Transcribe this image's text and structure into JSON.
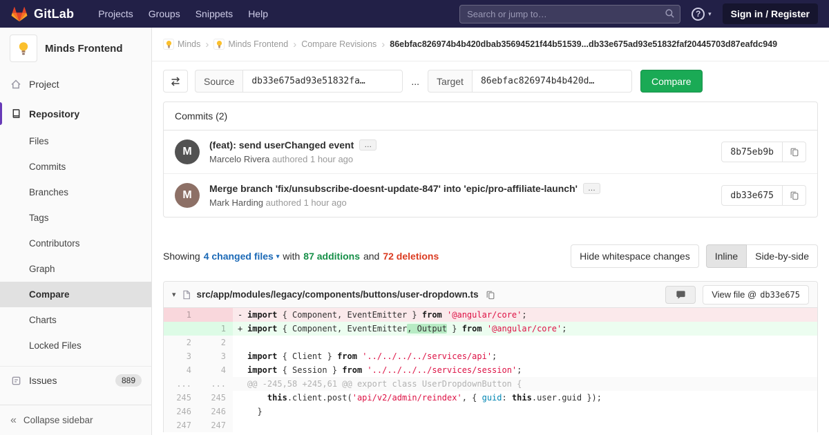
{
  "colors": {
    "navbar_bg": "#222047",
    "accent_purple": "#673ab7",
    "brand_orange": "#fc6d26",
    "green": "#1aaa55",
    "red": "#db3b21",
    "link_blue": "#1b69b6"
  },
  "navbar": {
    "brand": "GitLab",
    "links": [
      "Projects",
      "Groups",
      "Snippets",
      "Help"
    ],
    "search_placeholder": "Search or jump to…",
    "sign_in_label": "Sign in / Register"
  },
  "sidebar": {
    "project_name": "Minds Frontend",
    "top_items": [
      {
        "label": "Project",
        "active": false
      },
      {
        "label": "Repository",
        "active": true
      }
    ],
    "repository_subitems": [
      {
        "label": "Files",
        "active": false
      },
      {
        "label": "Commits",
        "active": false
      },
      {
        "label": "Branches",
        "active": false
      },
      {
        "label": "Tags",
        "active": false
      },
      {
        "label": "Contributors",
        "active": false
      },
      {
        "label": "Graph",
        "active": false
      },
      {
        "label": "Compare",
        "active": true
      },
      {
        "label": "Charts",
        "active": false
      },
      {
        "label": "Locked Files",
        "active": false
      }
    ],
    "issues_label": "Issues",
    "issues_count": "889",
    "collapse_label": "Collapse sidebar"
  },
  "breadcrumb": {
    "crumbs": [
      {
        "label": "Minds",
        "icon": "lightbulb"
      },
      {
        "label": "Minds Frontend",
        "icon": "lightbulb"
      },
      {
        "label": "Compare Revisions"
      }
    ],
    "current": "86ebfac826974b4b420dbab35694521f44b51539...db33e675ad93e51832faf20445703d87eafdc949"
  },
  "compare_form": {
    "source_label": "Source",
    "source_value": "db33e675ad93e51832fa…",
    "separator": "...",
    "target_label": "Target",
    "target_value": "86ebfac826974b4b420d…",
    "compare_button": "Compare"
  },
  "commits": {
    "title": "Commits (2)",
    "items": [
      {
        "title": "(feat): send userChanged event",
        "author": "Marcelo Rivera",
        "meta": "authored 1 hour ago",
        "sha": "8b75eb9b",
        "avatar_initial": "M",
        "avatar_color": "#525252"
      },
      {
        "title": "Merge branch 'fix/unsubscribe-doesnt-update-847' into 'epic/pro-affiliate-launch'",
        "author": "Mark Harding",
        "meta": "authored 1 hour ago",
        "sha": "db33e675",
        "avatar_initial": "M",
        "avatar_color": "#8d7066"
      }
    ]
  },
  "diff_summary": {
    "showing": "Showing",
    "files_link": "4 changed files",
    "with": "with",
    "additions": "87 additions",
    "and": "and",
    "deletions": "72 deletions",
    "hide_whitespace": "Hide whitespace changes",
    "inline": "Inline",
    "side_by_side": "Side-by-side"
  },
  "diff_file": {
    "path": "src/app/modules/legacy/components/buttons/user-dropdown.ts",
    "view_file_label": "View file @",
    "view_file_sha": "db33e675",
    "lines": [
      {
        "type": "removed",
        "old": "1",
        "new": "",
        "prefix": "-",
        "code": [
          [
            "k",
            "import"
          ],
          [
            "n",
            " { Component, EventEmitter } "
          ],
          [
            "k",
            "from"
          ],
          [
            "n",
            " "
          ],
          [
            "s",
            "'@angular/core'"
          ],
          [
            "n",
            ";"
          ]
        ]
      },
      {
        "type": "added",
        "old": "",
        "new": "1",
        "prefix": "+",
        "code": [
          [
            "k",
            "import"
          ],
          [
            "n",
            " { Component, EventEmitter"
          ],
          [
            "hl",
            ", Output"
          ],
          [
            "n",
            " } "
          ],
          [
            "k",
            "from"
          ],
          [
            "n",
            " "
          ],
          [
            "s",
            "'@angular/core'"
          ],
          [
            "n",
            ";"
          ]
        ]
      },
      {
        "type": "context",
        "old": "2",
        "new": "2",
        "prefix": "",
        "code": []
      },
      {
        "type": "context",
        "old": "3",
        "new": "3",
        "prefix": "",
        "code": [
          [
            "k",
            "import"
          ],
          [
            "n",
            " { Client } "
          ],
          [
            "k",
            "from"
          ],
          [
            "n",
            " "
          ],
          [
            "s",
            "'../../../../services/api'"
          ],
          [
            "n",
            ";"
          ]
        ]
      },
      {
        "type": "context",
        "old": "4",
        "new": "4",
        "prefix": "",
        "code": [
          [
            "k",
            "import"
          ],
          [
            "n",
            " { Session } "
          ],
          [
            "k",
            "from"
          ],
          [
            "n",
            " "
          ],
          [
            "s",
            "'../../../../services/session'"
          ],
          [
            "n",
            ";"
          ]
        ]
      },
      {
        "type": "match",
        "old": "...",
        "new": "...",
        "prefix": "",
        "code": [
          [
            "m",
            "@@ -245,58 +245,61 @@ export class UserDropdownButton {"
          ]
        ]
      },
      {
        "type": "context",
        "old": "245",
        "new": "245",
        "prefix": "",
        "code": [
          [
            "n",
            "    "
          ],
          [
            "k",
            "this"
          ],
          [
            "n",
            ".client.post("
          ],
          [
            "s",
            "'api/v2/admin/reindex'"
          ],
          [
            "n",
            ", { "
          ],
          [
            "v",
            "guid"
          ],
          [
            "n",
            ": "
          ],
          [
            "k",
            "this"
          ],
          [
            "n",
            ".user.guid });"
          ]
        ]
      },
      {
        "type": "context",
        "old": "246",
        "new": "246",
        "prefix": "",
        "code": [
          [
            "n",
            "  }"
          ]
        ]
      },
      {
        "type": "context",
        "old": "247",
        "new": "247",
        "prefix": "",
        "code": []
      }
    ]
  }
}
